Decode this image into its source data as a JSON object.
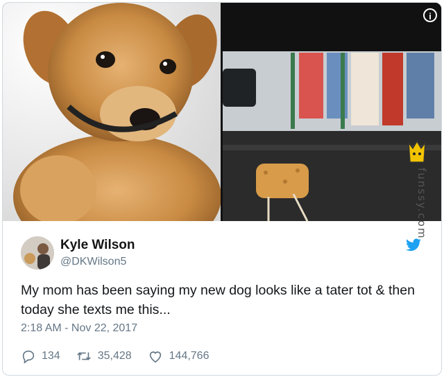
{
  "tweet": {
    "name": "Kyle Wilson",
    "handle": "@DKWilson5",
    "text": "My mom has been saying my new dog looks like a tater tot & then today she texts me this...",
    "timestamp": "2:18 AM - Nov 22, 2017",
    "replies": "134",
    "retweets": "35,428",
    "likes": "144,766"
  },
  "media": {
    "left_image": "puppy-photo",
    "right_image": "tater-tot-photo",
    "info_icon": "i"
  },
  "watermark": {
    "text": "funssy.com"
  },
  "colors": {
    "accent": "#1da1f2",
    "secondary_text": "#657786",
    "primary_text": "#14171a"
  }
}
